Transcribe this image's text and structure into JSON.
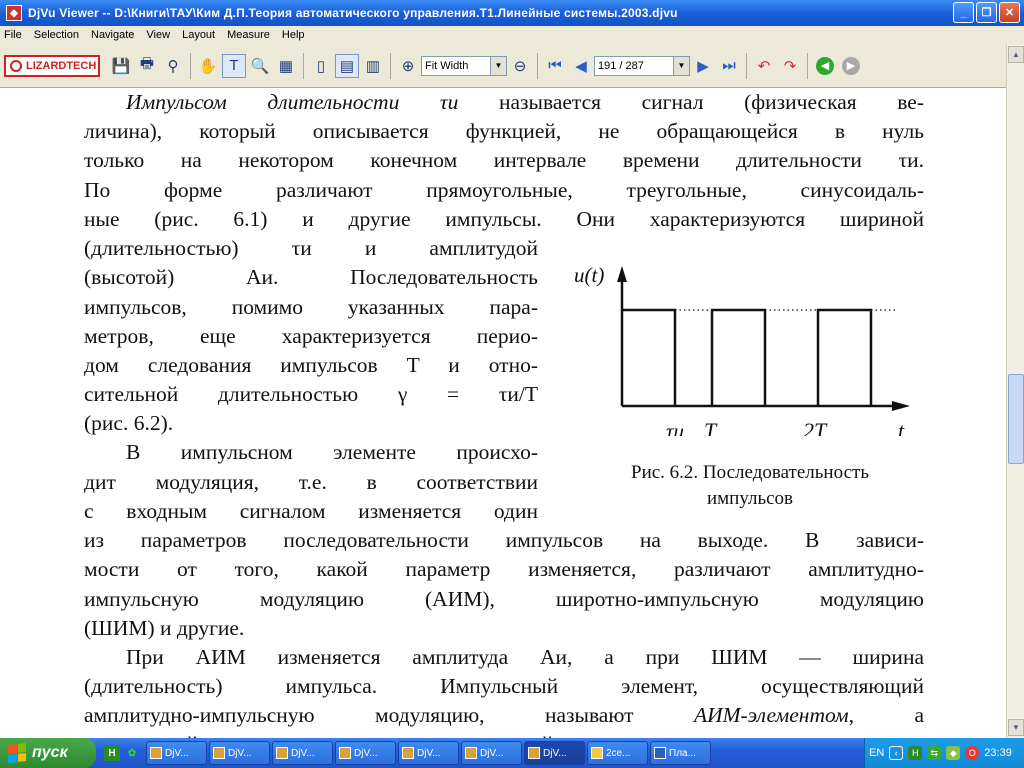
{
  "window": {
    "title": "DjVu Viewer -- D:\\Книги\\ТАУ\\Ким Д.П.Теория автоматического управления.Т1.Линейные системы.2003.djvu",
    "minimize": "_",
    "maximize": "❐",
    "close": "✕"
  },
  "menu": [
    "File",
    "Selection",
    "Navigate",
    "View",
    "Layout",
    "Measure",
    "Help"
  ],
  "toolbar": {
    "logo": "LIZARDTECH",
    "zoom_value": "Fit Width",
    "page_value": "191 / 287"
  },
  "doc": {
    "lines": [
      [
        "Импульсом длительности τи",
        " называется сигнал (физическая ве-"
      ],
      "личина), который описывается функцией, не обращающейся в нуль",
      "только на некотором конечном интервале времени длительности τи.",
      "По форме различают прямоугольные, треугольные, синусоидаль-",
      "ные (рис. 6.1) и другие импульсы. Они характеризуются шириной",
      "(длительностью) τи и амплитудой",
      "(высотой) Аи. Последовательность",
      "импульсов, помимо указанных пара-",
      "метров, еще характеризуется перио-",
      "дом следования импульсов T и отно-",
      "сительной длительностью γ = τи/T",
      "(рис. 6.2).",
      "В импульсном элементе происхо-",
      "дит модуляция, т.е. в соответствии",
      "с входным сигналом изменяется один",
      "из параметров последовательности импульсов на выходе. В зависи-",
      "мости от того, какой параметр изменяется, различают амплитудно-",
      "импульсную модуляцию (АИМ), широтно-импульсную модуляцию",
      "(ШИМ) и другие.",
      "При АИМ изменяется амплитуда Аи, а при ШИМ — ширина",
      "(длительность) импульса. Импульсный элемент, осуществляющий",
      [
        "амплитудно-импульсную модуляцию, называют ",
        "АИМ-элементом",
        ", а"
      ],
      "импульсный элемент, осуществляющий широтно-импульсную моду-"
    ]
  },
  "figure": {
    "y_label": "u(t)",
    "x_label": "t",
    "ticks": [
      "τи",
      "T",
      "2T"
    ],
    "caption_line1": "Рис. 6.2. Последовательность",
    "caption_line2": "импульсов"
  },
  "taskbar": {
    "start": "пуск",
    "tasks": [
      "DjV...",
      "DjV...",
      "DjV...",
      "DjV...",
      "DjV...",
      "DjV...",
      "DjV...",
      "2се...",
      "Пла..."
    ],
    "lang": "EN",
    "clock": "23:39"
  }
}
